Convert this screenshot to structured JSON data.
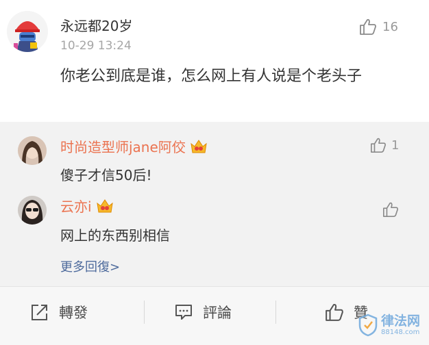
{
  "main_comment": {
    "username": "永远都20岁",
    "time": "10-29 13:24",
    "like_count": "16",
    "text": "你老公到底是谁，怎么网上有人说是个老头子"
  },
  "replies": [
    {
      "username": "时尚造型师jane阿佼",
      "text": "傻子才信50后!",
      "like_count": "1"
    },
    {
      "username": "云亦i",
      "text": "网上的东西别相信",
      "like_count": ""
    }
  ],
  "more_replies_label": "更多回復>",
  "footer": {
    "repost_label": "轉發",
    "comment_label": "評論",
    "like_label": "贊"
  },
  "watermark": {
    "title": "律法网",
    "domain": "88148.com"
  },
  "colors": {
    "username_orange": "#eb7350",
    "link_blue": "#4d6a9c",
    "reply_bg": "#f2f2f2"
  }
}
